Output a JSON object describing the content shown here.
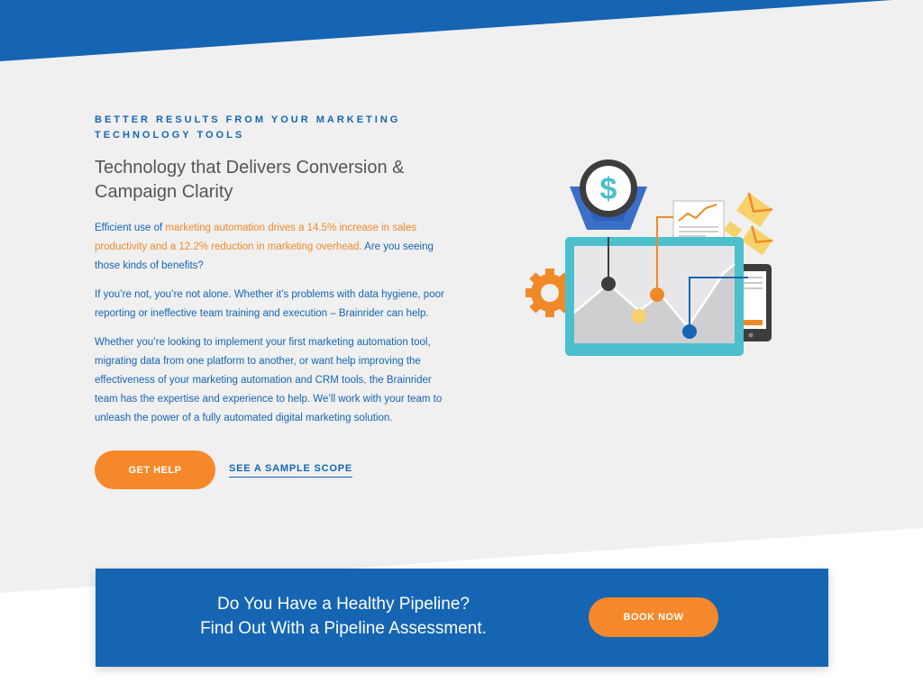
{
  "hero": {
    "eyebrow": "BETTER RESULTS FROM YOUR MARKETING TECHNOLOGY TOOLS",
    "headline": "Technology that Delivers Conversion & Campaign Clarity",
    "paragraph1": {
      "part1": "Efficient use of ",
      "highlight": "marketing automation drives a 14.5% increase in sales productivity and a 12.2% reduction in marketing overhead.",
      "part2": " Are you seeing those kinds of benefits?"
    },
    "paragraph2": "If you’re not, you’re not alone. Whether it’s problems with data hygiene, poor reporting or ineffective team training and execution – Brainrider can help.",
    "paragraph3": "Whether you’re looking to implement your first marketing automation tool, migrating data from one platform to another, or want help improving the effectiveness of your marketing automation and CRM tools, the Brainrider team has the expertise and experience to help. We’ll work with your team to unleash the power of a fully automated digital marketing solution.",
    "cta_primary": "GET HELP",
    "cta_secondary": "SEE A SAMPLE SCOPE"
  },
  "illustration": {
    "funnel_symbol": "$",
    "icons": [
      "dollar-funnel-icon",
      "gear-icon",
      "monitor-chart-icon",
      "report-document-icon",
      "envelope-icon",
      "tablet-icon"
    ]
  },
  "banner": {
    "line1": "Do You Have a Healthy Pipeline?",
    "line2": "Find Out With a Pipeline Assessment.",
    "button": "BOOK NOW"
  },
  "colors": {
    "brand_blue": "#1565b3",
    "accent_orange": "#f5882a",
    "background_gray": "#f0f0f1",
    "teal": "#4bbfcb",
    "yellow": "#f7d26a"
  }
}
